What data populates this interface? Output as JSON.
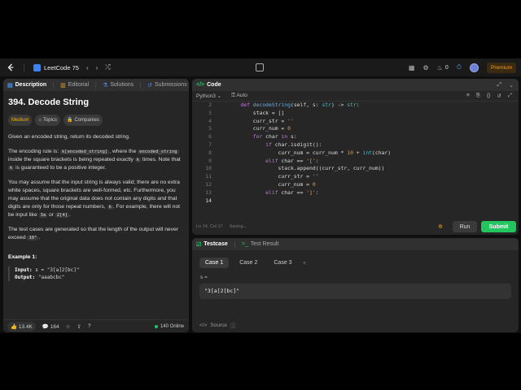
{
  "topbar": {
    "list_title": "LeetCode 75",
    "notification_count": "0",
    "premium_label": "Premium"
  },
  "desc_tabs": [
    {
      "label": "Description"
    },
    {
      "label": "Editorial"
    },
    {
      "label": "Solutions"
    },
    {
      "label": "Submissions"
    }
  ],
  "problem": {
    "title": "394. Decode String",
    "difficulty": "Medium",
    "topics_label": "Topics",
    "companies_label": "Companies",
    "p1": "Given an encoded string, return its decoded string.",
    "p2_a": "The encoding rule is: ",
    "p2_code1": "k[encoded_string]",
    "p2_b": ", where the ",
    "p2_code2": "encoded_string",
    "p2_c": " inside the square brackets is being repeated exactly ",
    "p2_code3": "k",
    "p2_d": " times. Note that ",
    "p2_code4": "k",
    "p2_e": " is guaranteed to be a positive integer.",
    "p3_a": "You may assume that the input string is always valid; there are no extra white spaces, square brackets are well-formed, etc. Furthermore, you may assume that the original data does not contain any digits and that digits are only for those repeat numbers, ",
    "p3_code1": "k",
    "p3_b": ". For example, there will not be input like ",
    "p3_code2": "3a",
    "p3_c": " or ",
    "p3_code3": "2[4]",
    "p3_d": ".",
    "p4_a": "The test cases are generated so that the length of the output will never exceed ",
    "p4_code": "10⁵",
    "p4_b": ".",
    "example_title": "Example 1:",
    "input_label": "Input:",
    "input_value": " s = \"3[a]2[bc]\"",
    "output_label": "Output:",
    "output_value": " \"aaabcbc\""
  },
  "desc_footer": {
    "likes": "13.4K",
    "comments": "164",
    "online": "140 Online"
  },
  "code_panel": {
    "tab_label": "Code",
    "language": "Python3",
    "auto_label": "Auto",
    "status_line": "Ln 14, Col 17",
    "status_saving": "Saving...",
    "run_label": "Run",
    "submit_label": "Submit",
    "line_numbers": [
      "2",
      "3",
      "4",
      "5",
      "6",
      "7",
      "8",
      "9",
      "10",
      "11",
      "12",
      "13",
      "14"
    ]
  },
  "test_panel": {
    "testcase_label": "Testcase",
    "result_label": "Test Result",
    "cases": [
      "Case 1",
      "Case 2",
      "Case 3"
    ],
    "var_label": "s =",
    "var_value": "\"3[a]2[bc]\"",
    "source_label": "Source"
  }
}
